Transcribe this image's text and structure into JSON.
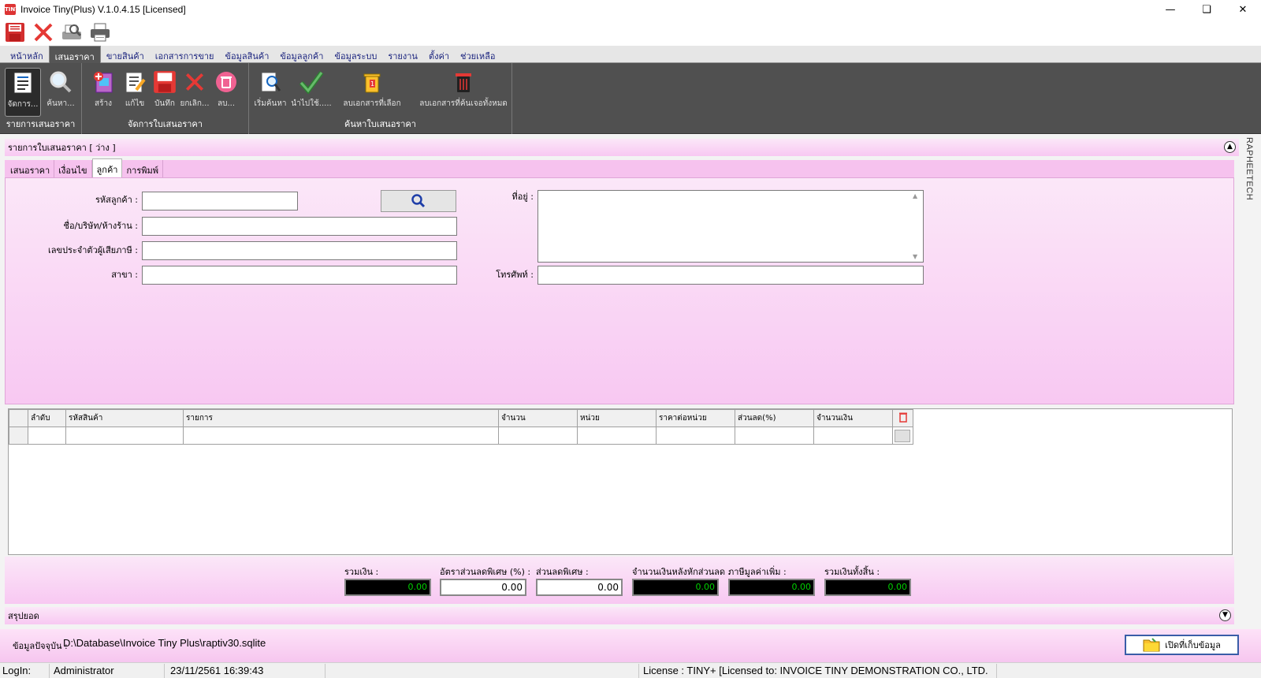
{
  "window": {
    "title": "Invoice Tiny(Plus)  V.1.0.4.15 [Licensed]",
    "app_icon_text": "TINY",
    "controls": [
      "minimize-icon",
      "restore-icon",
      "close-icon"
    ]
  },
  "quick_access": [
    {
      "name": "save",
      "icon": "floppy-disk-icon"
    },
    {
      "name": "cancel",
      "icon": "red-x-icon"
    },
    {
      "name": "print-preview",
      "icon": "print-preview-icon"
    },
    {
      "name": "print",
      "icon": "printer-icon"
    }
  ],
  "menu_tabs": [
    "หน้าหลัก",
    "เสนอราคา",
    "ขายสินค้า",
    "เอกสารการขาย",
    "ข้อมูลสินค้า",
    "ข้อมูลลูกค้า",
    "ข้อมูลระบบ",
    "รายงาน",
    "ตั้งค่า",
    "ช่วยเหลือ"
  ],
  "menu_active": "เสนอราคา",
  "ribbon": {
    "groups": [
      {
        "label": "รายการเสนอราคา",
        "buttons": [
          {
            "label": "จัดการ...",
            "icon": "document-list-icon",
            "selected": true
          },
          {
            "label": "ค้นหา...",
            "icon": "magnifier-icon",
            "selected": false
          }
        ]
      },
      {
        "label": "จัดการใบเสนอราคา",
        "buttons": [
          {
            "label": "สร้าง",
            "icon": "create-document-icon"
          },
          {
            "label": "แก้ไข",
            "icon": "edit-document-icon"
          },
          {
            "label": "บันทึก",
            "icon": "floppy-disk-icon"
          },
          {
            "label": "ยกเลิก...",
            "icon": "red-x-icon"
          },
          {
            "label": "ลบ...",
            "icon": "trash-circle-icon"
          }
        ]
      },
      {
        "label": "ค้นหาใบเสนอราคา",
        "buttons": [
          {
            "label": "เริ่มค้นหา",
            "icon": "search-document-icon"
          },
          {
            "label": "นำไปใช้.....",
            "icon": "green-check-icon"
          },
          {
            "label": "ลบเอกสารที่เลือก",
            "icon": "delete-selected-icon"
          },
          {
            "label": "ลบเอกสารที่ค้นเจอทั้งหมด",
            "icon": "delete-all-icon"
          }
        ]
      }
    ]
  },
  "list_header": "รายการใบเสนอราคา [ ว่าง ]",
  "side_label": "RAPHEETECH",
  "sub_tabs": [
    "เสนอราคา",
    "เงื่อนไข",
    "ลูกค้า",
    "การพิมพ์"
  ],
  "sub_tab_active": "ลูกค้า",
  "customer_form": {
    "customer_code_label": "รหัสลูกค้า :",
    "customer_code_value": "",
    "name_label": "ชื่อ/บริษัท/ห้างร้าน :",
    "name_value": "",
    "tax_id_label": "เลขประจำตัวผู้เสียภาษี :",
    "tax_id_value": "",
    "branch_label": "สาขา :",
    "branch_value": "",
    "address_label": "ที่อยู่ :",
    "address_value": "",
    "phone_label": "โทรศัพท์ :",
    "phone_value": ""
  },
  "grid": {
    "columns": [
      "ลำดับ",
      "รหัสสินค้า",
      "รายการ",
      "จำนวน",
      "หน่วย",
      "ราคาต่อหน่วย",
      "ส่วนลด(%)",
      "จำนวนเงิน"
    ],
    "delete_icon": "trash-icon",
    "rows": [
      [
        "",
        "",
        "",
        "",
        "",
        "",
        "",
        ""
      ]
    ]
  },
  "totals": [
    {
      "label": "รวมเงิน :",
      "value": "0.00",
      "style": "dark"
    },
    {
      "label": "อัตราส่วนลดพิเศษ (%) :",
      "value": "0.00",
      "style": "light"
    },
    {
      "label": "ส่วนลดพิเศษ :",
      "value": "0.00",
      "style": "light"
    },
    {
      "label": "จำนวนเงินหลังหักส่วนลด :",
      "value": "0.00",
      "style": "dark"
    },
    {
      "label": "ภาษีมูลค่าเพิ่ม :",
      "value": "0.00",
      "style": "dark"
    },
    {
      "label": "รวมเงินทั้งสิ้น :",
      "value": "0.00",
      "style": "dark"
    }
  ],
  "summary_header": "สรุปยอด",
  "data_source": {
    "label": "ข้อมูลปัจจุบัน :",
    "path": "D:\\Database\\Invoice Tiny Plus\\raptiv30.sqlite",
    "open_button": "เปิดที่เก็บข้อมูล"
  },
  "status": {
    "login_label": "LogIn:",
    "user": "Administrator",
    "datetime": "23/11/2561 16:39:43",
    "license": "License : TINY+ [Licensed to: INVOICE TINY DEMONSTRATION CO., LTD."
  },
  "colors": {
    "ribbon_bg": "#505050",
    "pink_light": "#fbe7f8",
    "pink_dark": "#f8c8f2",
    "menu_text": "#1a237e",
    "total_text": "#00d000"
  }
}
